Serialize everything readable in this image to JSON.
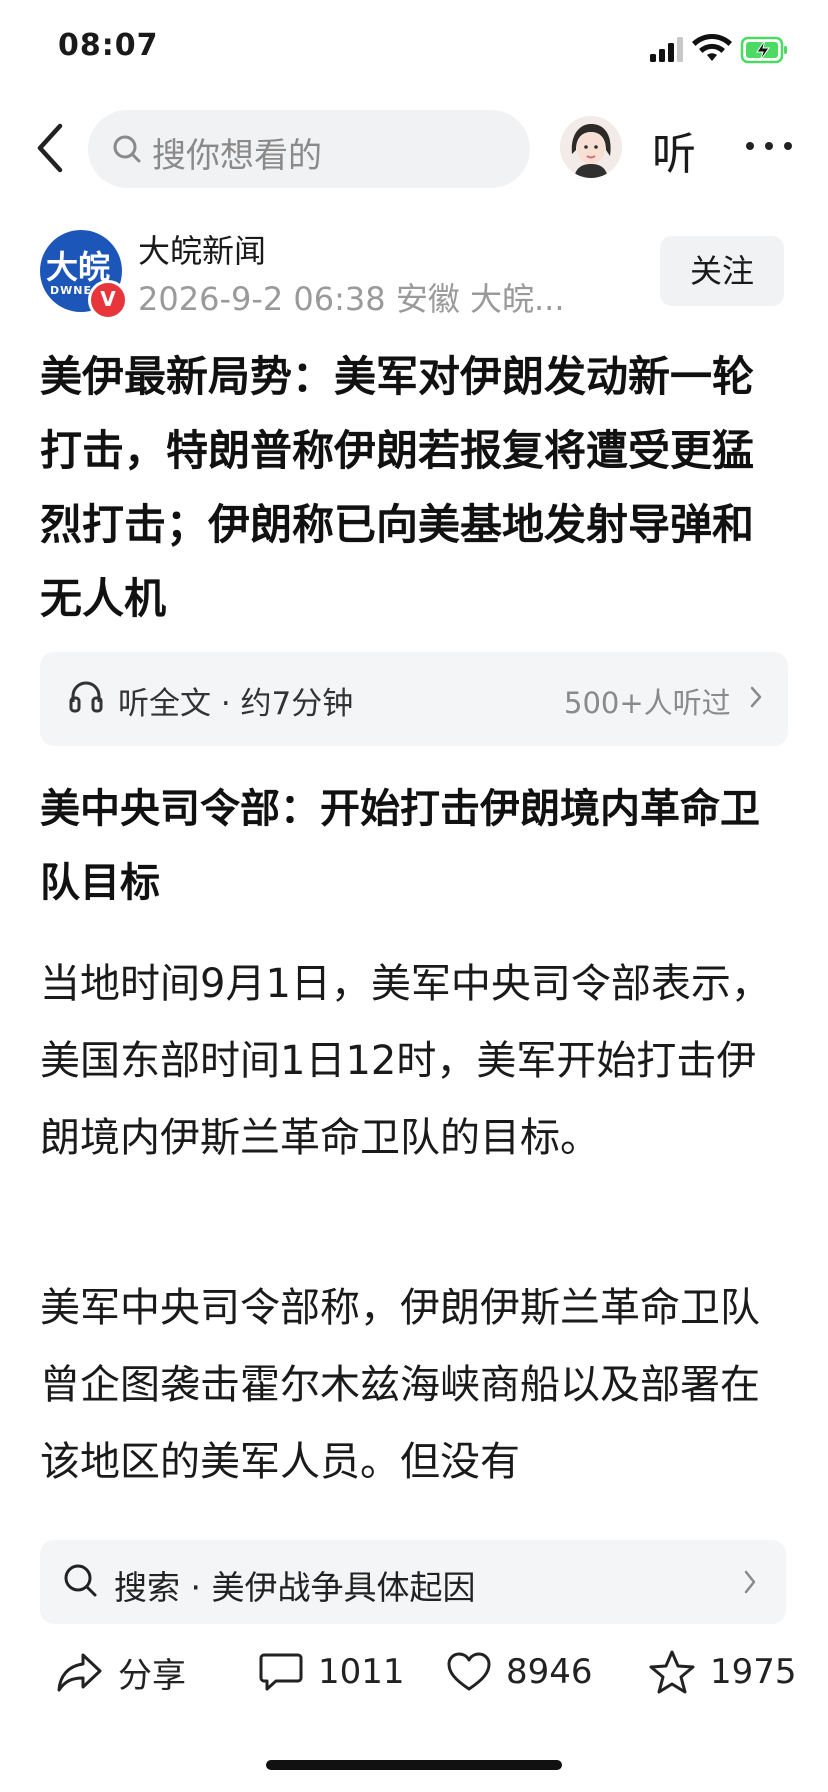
{
  "status_bar": {
    "time": "08:07",
    "icons": [
      "signal-icon",
      "wifi-icon",
      "battery-charging-icon"
    ],
    "battery_color": "#4cd964"
  },
  "nav": {
    "search_placeholder": "搜你想看的",
    "listen_label": "听",
    "icons": [
      "back-icon",
      "search-icon",
      "avatar",
      "more-icon"
    ]
  },
  "author": {
    "logo_text": "大皖",
    "logo_sub": "DWNE",
    "verified_mark": "V",
    "name": "大皖新闻",
    "meta": "2026-9-2 06:38 安徽 大皖...",
    "follow_label": "关注",
    "brand_color": "#1c56b8"
  },
  "article": {
    "title": "美伊最新局势：美军对伊朗发动新一轮打击，特朗普称伊朗若报复将遭受更猛烈打击；伊朗称已向美基地发射导弹和无人机",
    "listen_full": "听全文 · 约7分钟",
    "listeners": "500+人听过",
    "subheading": "美中央司令部：开始打击伊朗境内革命卫队目标",
    "paragraphs": [
      "当地时间9月1日，美军中央司令部表示，美国东部时间1日12时，美军开始打击伊朗境内伊斯兰革命卫队的目标。",
      "美军中央司令部称，伊朗伊斯兰革命卫队曾企图袭击霍尔木兹海峡商船以及部署在该地区的美军人员。但没有"
    ]
  },
  "bottom": {
    "search_suggestion": "搜索 · 美伊战争具体起因",
    "share_label": "分享",
    "comment_count": "1011",
    "like_count": "8946",
    "favorite_count": "1975"
  }
}
